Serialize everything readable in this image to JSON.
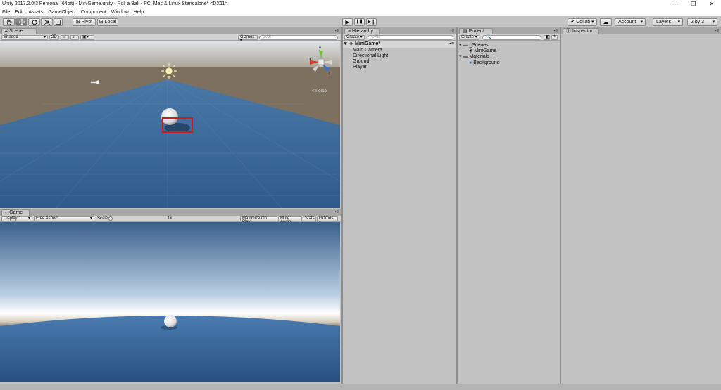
{
  "window": {
    "title": "Unity 2017.2.0f3 Personal (64bit) - MiniGame.unity - Roll a Ball - PC, Mac & Linux Standalone* <DX11>",
    "minimize_glyph": "—",
    "maximize_glyph": "❐",
    "close_glyph": "✕"
  },
  "menu": [
    "File",
    "Edit",
    "Assets",
    "GameObject",
    "Component",
    "Window",
    "Help"
  ],
  "toolbar": {
    "transform_tools": [
      "hand-icon",
      "move-icon",
      "rotate-icon",
      "scale-icon",
      "rect-icon"
    ],
    "pivot_label": "Pivot",
    "local_label": "Local",
    "play_glyph": "▶",
    "pause_glyph": "❚❚",
    "step_glyph": "▶❙",
    "collab_label": "Collab ▾",
    "cloud_glyph": "☁",
    "account_label": "Account",
    "layers_label": "Layers",
    "layout_label": "2 by 3"
  },
  "scene": {
    "tab_label": "Scene",
    "shading_mode": "Shaded",
    "mode_2d": "2D",
    "light_glyph": "☼",
    "audio_glyph": "♪",
    "fx_glyph": "▣",
    "gizmos_label": "Gizmos ▾",
    "search_placeholder": "⊙All",
    "persp_label": "< Persp",
    "colors": {
      "sky": "#dfe6ea",
      "ground": "#7d705f",
      "floor": "#3b6c9e",
      "highlight": "#c8201e"
    }
  },
  "game": {
    "tab_label": "Game",
    "display_label": "Display 1",
    "aspect_label": "Free Aspect",
    "scale_label": "Scale",
    "scale_value": "1x",
    "maximize_label": "Maximize On Play",
    "mute_label": "Mute Audio",
    "stats_label": "Stats",
    "gizmos_label": "Gizmos ▾"
  },
  "hierarchy": {
    "tab_label": "Hierarchy",
    "create_label": "Create ▾",
    "search_placeholder": "⊙All",
    "scene_name": "MiniGame*",
    "items": [
      "Main Camera",
      "Directional Light",
      "Ground",
      "Player"
    ]
  },
  "project": {
    "tab_label": "Project",
    "create_label": "Create ▾",
    "search_placeholder": "🔍",
    "folders": [
      {
        "name": "_Scenes",
        "children": [
          "MiniGame"
        ]
      },
      {
        "name": "Materials",
        "children": [
          "Background"
        ]
      }
    ]
  },
  "inspector": {
    "tab_label": "Inspector"
  },
  "panel_menu_glyph": "▪≡"
}
